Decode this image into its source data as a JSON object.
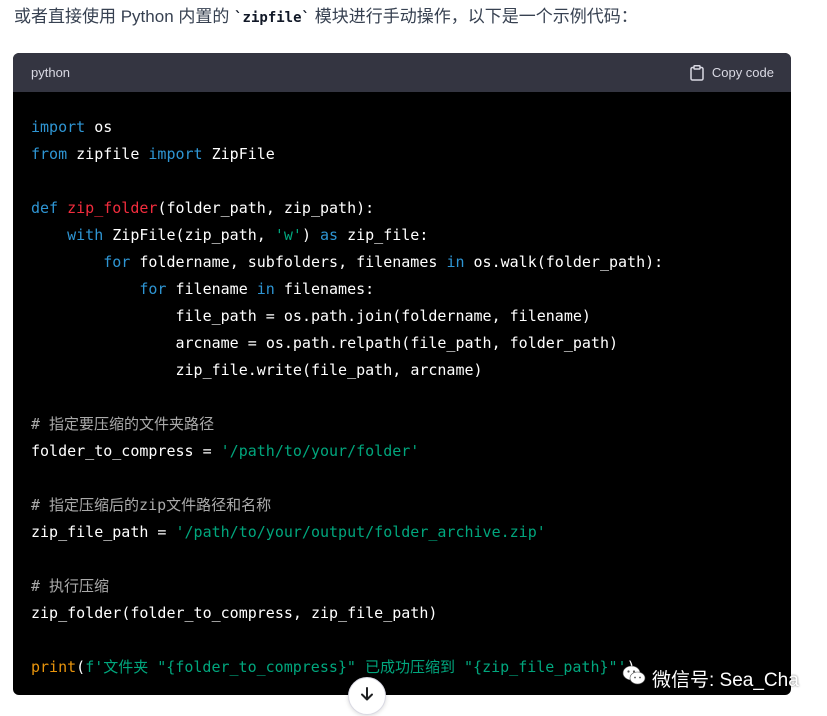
{
  "intro": {
    "before": "或者直接使用 Python 内置的 ",
    "code": "`zipfile`",
    "after": " 模块进行手动操作，以下是一个示例代码："
  },
  "code_block": {
    "language": "python",
    "copy_label": "Copy code",
    "lines": [
      "import os",
      "from zipfile import ZipFile",
      "",
      "def zip_folder(folder_path, zip_path):",
      "    with ZipFile(zip_path, 'w') as zip_file:",
      "        for foldername, subfolders, filenames in os.walk(folder_path):",
      "            for filename in filenames:",
      "                file_path = os.path.join(foldername, filename)",
      "                arcname = os.path.relpath(file_path, folder_path)",
      "                zip_file.write(file_path, arcname)",
      "",
      "# 指定要压缩的文件夹路径",
      "folder_to_compress = '/path/to/your/folder'",
      "",
      "# 指定压缩后的zip文件路径和名称",
      "zip_file_path = '/path/to/your/output/folder_archive.zip'",
      "",
      "# 执行压缩",
      "zip_folder(folder_to_compress, zip_file_path)",
      "",
      "print(f'文件夹 \"{folder_to_compress}\" 已成功压缩到 \"{zip_file_path}\"')"
    ]
  },
  "scroll_button": {
    "icon": "arrow-down-icon"
  },
  "watermark": {
    "text": "微信号: Sea_Cha",
    "icon": "wechat-icon"
  },
  "colors": {
    "keyword": "#2e95d3",
    "function": "#f22c3d",
    "string": "#00a67d",
    "comment": "#aaaaaa",
    "header_bg": "#343541",
    "code_bg": "#000000"
  }
}
